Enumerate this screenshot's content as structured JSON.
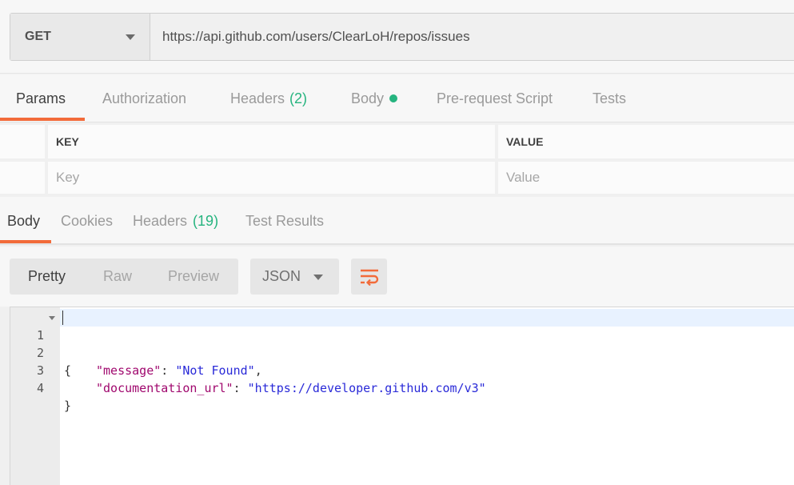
{
  "request": {
    "method": "GET",
    "url": "https://api.github.com/users/ClearLoH/repos/issues"
  },
  "request_tabs": {
    "params": "Params",
    "authorization": "Authorization",
    "headers": "Headers",
    "headers_count": "(2)",
    "body": "Body",
    "prerequest": "Pre-request Script",
    "tests": "Tests"
  },
  "params_table": {
    "key_header": "KEY",
    "value_header": "VALUE",
    "key_placeholder": "Key",
    "value_placeholder": "Value"
  },
  "response_tabs": {
    "body": "Body",
    "cookies": "Cookies",
    "headers": "Headers",
    "headers_count": "(19)",
    "test_results": "Test Results"
  },
  "toolbar": {
    "pretty": "Pretty",
    "raw": "Raw",
    "preview": "Preview",
    "format": "JSON"
  },
  "editor": {
    "line_numbers": [
      "1",
      "2",
      "3",
      "4"
    ],
    "line1": "{",
    "line2_key": "\"message\"",
    "line2_value": "\"Not Found\"",
    "line3_key": "\"documentation_url\"",
    "line3_value": "\"https://developer.github.com/v3\"",
    "line4": "}"
  },
  "colors": {
    "accent": "#f26b3a",
    "green": "#26b47f"
  }
}
